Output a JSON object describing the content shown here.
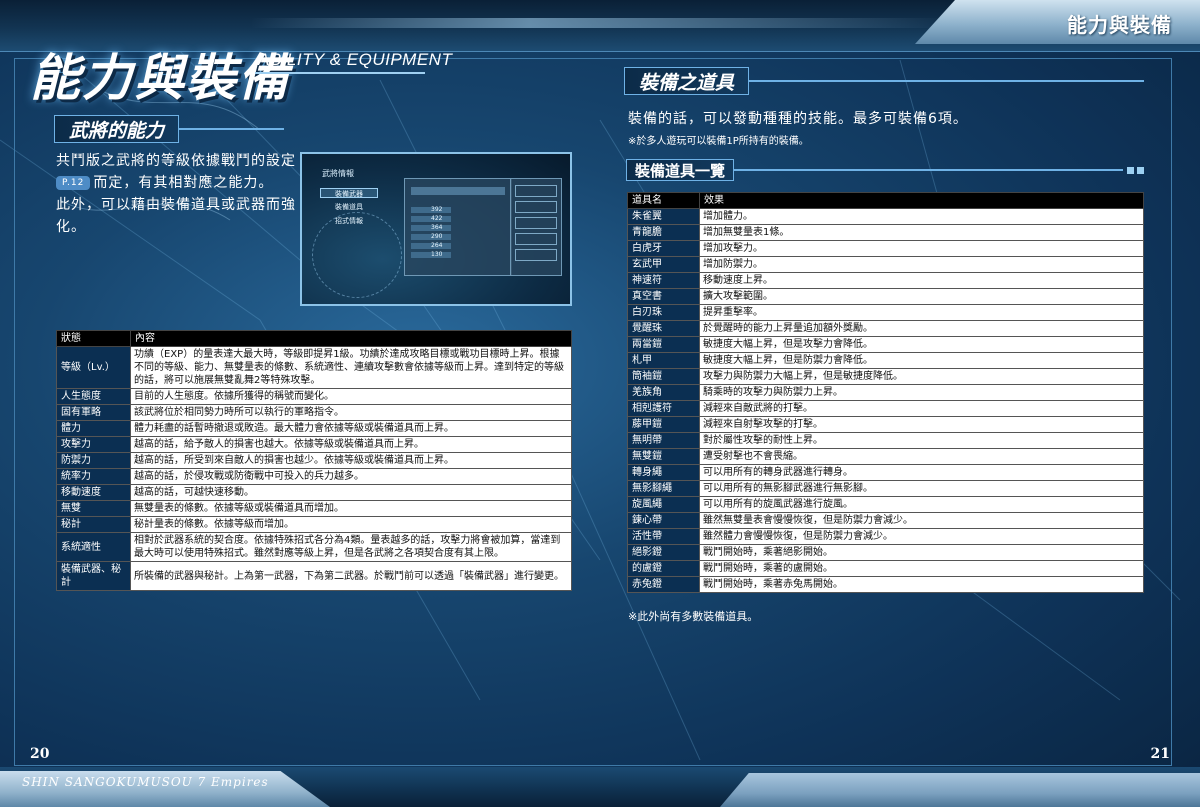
{
  "header": {
    "tab_title": "能力與裝備",
    "main_title": "能力與裝備",
    "main_title_sub": "ABILITY & EQUIPMENT"
  },
  "left": {
    "section_title": "武將的能力",
    "intro_line1": "共鬥版之武將的等級依據戰鬥的設定",
    "page_ref": "P.12",
    "intro_line2": "而定，有其相對應之能力。",
    "intro_line3": "此外，可以藉由裝備道具或武器而強",
    "intro_line4": "化。",
    "screenshot": {
      "menu_title": "武將情報",
      "menu_items": [
        "裝備武器",
        "裝備道具",
        "招式情報"
      ],
      "stat_values": [
        "392",
        "422",
        "364",
        "290",
        "264",
        "130"
      ]
    },
    "table": {
      "headers": [
        "狀態",
        "內容"
      ],
      "rows": [
        {
          "key": "等級（Lv.）",
          "value": "功績（EXP）的量表達大最大時，等級即提昇1級。功績於達成攻略目標或戰功目標時上昇。根據不同的等級、能力、無雙量表的條數、系統適性、連續攻擊數會依據等級而上昇。達到特定的等級的話，將可以施展無雙亂舞2等特殊攻擊。"
        },
        {
          "key": "人生態度",
          "value": "目前的人生態度。依據所獲得的稱號而變化。"
        },
        {
          "key": "固有軍略",
          "value": "該武將位於相同勢力時所可以執行的軍略指令。"
        },
        {
          "key": "體力",
          "value": "體力耗盡的話暫時撤退或敗造。最大體力會依據等級或裝備道具而上昇。"
        },
        {
          "key": "攻擊力",
          "value": "越高的話，給予敵人的損害也越大。依據等級或裝備道具而上昇。"
        },
        {
          "key": "防禦力",
          "value": "越高的話，所受到來自敵人的損害也越少。依據等級或裝備道具而上昇。"
        },
        {
          "key": "統率力",
          "value": "越高的話，於侵攻戰或防衛戰中可投入的兵力越多。"
        },
        {
          "key": "移動速度",
          "value": "越高的話，可越快速移動。"
        },
        {
          "key": "無雙",
          "value": "無雙量表的條數。依據等級或裝備道具而增加。"
        },
        {
          "key": "秘計",
          "value": "秘計量表的條數。依據等級而增加。"
        },
        {
          "key": "系統適性",
          "value": "相對於武器系統的契合度。依據特殊招式各分為4類。量表越多的話，攻擊力將會被加算，當達到最大時可以使用特殊招式。雖然對應等級上昇，但是各武將之各項契合度有其上限。"
        },
        {
          "key": "裝備武器、秘計",
          "value": "所裝備的武器與秘計。上為第一武器，下為第二武器。於戰鬥前可以透過「裝備武器」進行變更。"
        }
      ]
    }
  },
  "right": {
    "section_title": "裝備之道具",
    "intro": "裝備的話，可以發動種種的技能。最多可裝備6項。",
    "note": "※於多人遊玩可以裝備1P所持有的裝備。",
    "list_title": "裝備道具一覽",
    "table": {
      "headers": [
        "道具名",
        "效果"
      ],
      "rows": [
        {
          "key": "朱雀翼",
          "value": "增加體力。"
        },
        {
          "key": "青龍膽",
          "value": "增加無雙量表1條。"
        },
        {
          "key": "白虎牙",
          "value": "增加攻擊力。"
        },
        {
          "key": "玄武甲",
          "value": "增加防禦力。"
        },
        {
          "key": "神速符",
          "value": "移動速度上昇。"
        },
        {
          "key": "真空書",
          "value": "擴大攻擊範圍。"
        },
        {
          "key": "白刃珠",
          "value": "提昇重擊率。"
        },
        {
          "key": "覺醒珠",
          "value": "於覺醒時的能力上昇量追加額外獎勵。"
        },
        {
          "key": "兩當鎧",
          "value": "敏捷度大幅上昇，但是攻擊力會降低。"
        },
        {
          "key": "札甲",
          "value": "敏捷度大幅上昇，但是防禦力會降低。"
        },
        {
          "key": "筒袖鎧",
          "value": "攻擊力與防禦力大幅上昇，但是敏捷度降低。"
        },
        {
          "key": "羌族角",
          "value": "騎乘時的攻擊力與防禦力上昇。"
        },
        {
          "key": "相剋護符",
          "value": "減輕來自敵武將的打擊。"
        },
        {
          "key": "藤甲鎧",
          "value": "減輕來自射擊攻擊的打擊。"
        },
        {
          "key": "無明帶",
          "value": "對於屬性攻擊的耐性上昇。"
        },
        {
          "key": "無雙鎧",
          "value": "遭受射擊也不會畏縮。"
        },
        {
          "key": "轉身繩",
          "value": "可以用所有的轉身武器進行轉身。"
        },
        {
          "key": "無影腳繩",
          "value": "可以用所有的無影腳武器進行無影腳。"
        },
        {
          "key": "旋風繩",
          "value": "可以用所有的旋風武器進行旋風。"
        },
        {
          "key": "鍊心帶",
          "value": "雖然無雙量表會慢慢恢復，但是防禦力會減少。"
        },
        {
          "key": "活性帶",
          "value": "雖然體力會慢慢恢復，但是防禦力會減少。"
        },
        {
          "key": "絕影鐙",
          "value": "戰鬥開始時，乘著絕影開始。"
        },
        {
          "key": "的盧鐙",
          "value": "戰鬥開始時，乘著的盧開始。"
        },
        {
          "key": "赤兔鐙",
          "value": "戰鬥開始時，乘著赤兔馬開始。"
        }
      ]
    },
    "footnote": "※此外尚有多數裝備道具。"
  },
  "footer": {
    "game_title": "SHIN SANGOKUMUSOU 7 Empires",
    "page_left": "20",
    "page_right": "21"
  },
  "colors": {
    "background": "#17466f",
    "accent": "#6fb2e6",
    "table_key_bg": "#0b2f52",
    "table_header_bg": "#000000"
  }
}
